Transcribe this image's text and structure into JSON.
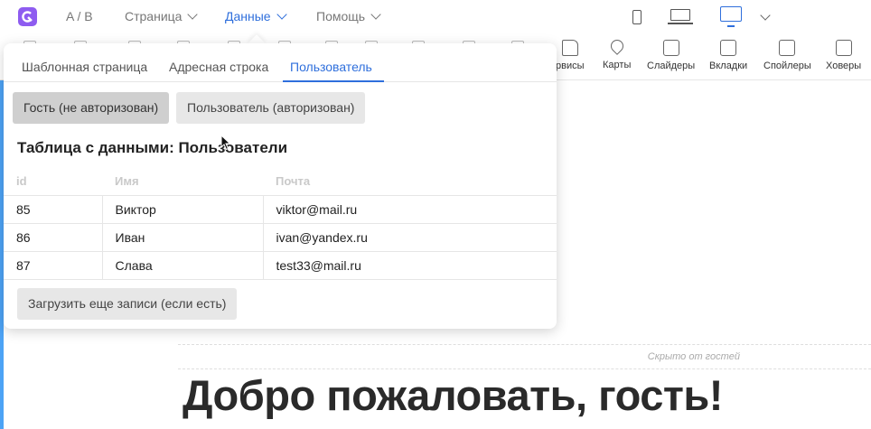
{
  "topbar": {
    "ab_label": "A / B",
    "nav": [
      {
        "label": "Страница"
      },
      {
        "label": "Данные",
        "active": true
      },
      {
        "label": "Помощь"
      }
    ],
    "devices": [
      "phone-icon",
      "laptop-icon",
      "desktop-icon"
    ],
    "active_device": "desktop-icon"
  },
  "toolbar": {
    "items": [
      {
        "label": "рвисы",
        "icon": "like-icon"
      },
      {
        "label": "Карты",
        "icon": "map-pin-icon"
      },
      {
        "label": "Слайдеры",
        "icon": "slider-icon"
      },
      {
        "label": "Вкладки",
        "icon": "tabs-icon"
      },
      {
        "label": "Спойлеры",
        "icon": "spoiler-icon"
      },
      {
        "label": "Ховеры",
        "icon": "hover-icon"
      }
    ]
  },
  "panel": {
    "tabs": [
      {
        "label": "Шаблонная страница"
      },
      {
        "label": "Адресная строка"
      },
      {
        "label": "Пользователь",
        "active": true
      }
    ],
    "guest_button": "Гость (не авторизован)",
    "user_button": "Пользователь (авторизован)",
    "table_title": "Таблица с данными: Пользователи",
    "table": {
      "headers": [
        "id",
        "Имя",
        "Почта"
      ],
      "rows": [
        [
          "85",
          "Виктор",
          "viktor@mail.ru"
        ],
        [
          "86",
          "Иван",
          "ivan@yandex.ru"
        ],
        [
          "87",
          "Слава",
          "test33@mail.ru"
        ]
      ]
    },
    "load_more_button": "Загрузить еще записи (если есть)"
  },
  "canvas": {
    "hidden_note": "Скрыто от гостей",
    "welcome_heading": "Добро пожаловать, гость!"
  },
  "colors": {
    "accent": "#2f6fdc",
    "logo": "#8e5cf0",
    "left_accent": "#4da3f5"
  }
}
